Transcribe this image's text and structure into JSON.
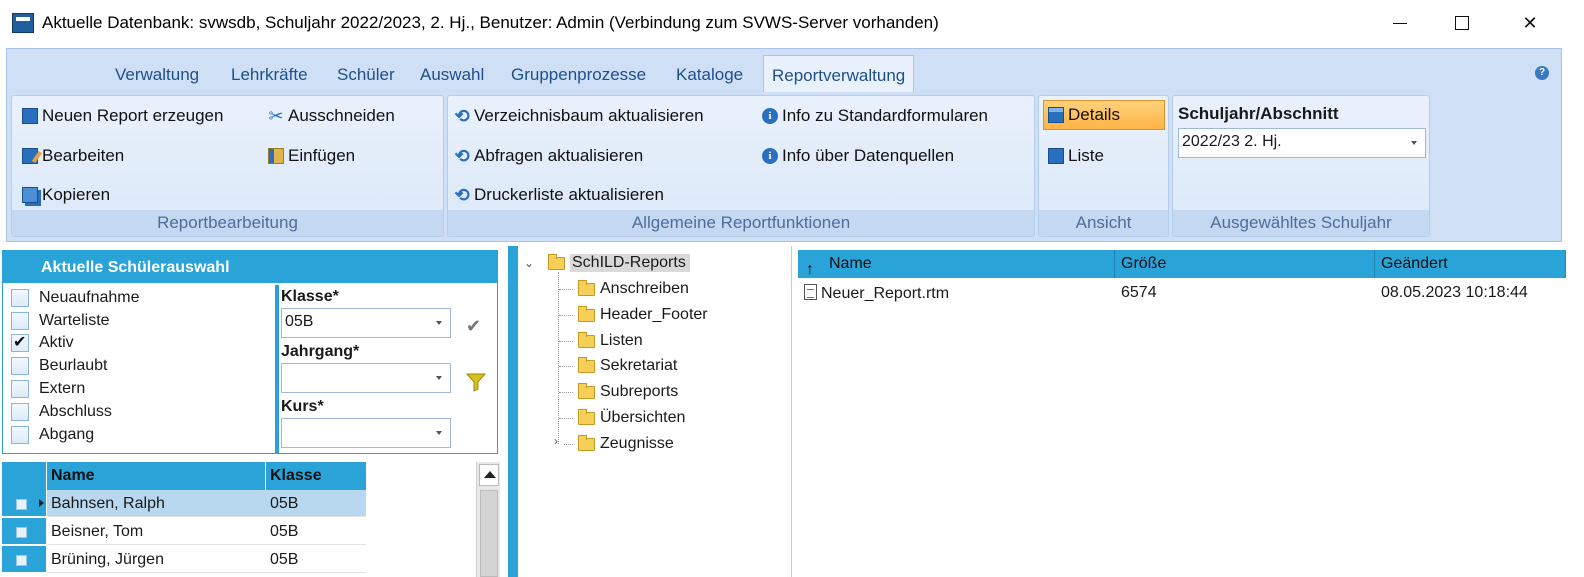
{
  "window": {
    "title": "Aktuelle Datenbank: svwsdb, Schuljahr 2022/2023, 2. Hj., Benutzer: Admin (Verbindung zum SVWS-Server vorhanden)"
  },
  "ribbon": {
    "tabs": [
      {
        "label": "Verwaltung"
      },
      {
        "label": "Lehrkräfte"
      },
      {
        "label": "Schüler"
      },
      {
        "label": "Auswahl"
      },
      {
        "label": "Gruppenprozesse"
      },
      {
        "label": "Kataloge"
      },
      {
        "label": "Reportverwaltung",
        "active": true
      }
    ],
    "reportbearbeitung": {
      "label": "Reportbearbeitung",
      "new_report": "Neuen Report erzeugen",
      "edit": "Bearbeiten",
      "copy": "Kopieren",
      "cut": "Ausschneiden",
      "paste": "Einfügen"
    },
    "allgemein": {
      "label": "Allgemeine Reportfunktionen",
      "refresh_tree": "Verzeichnisbaum aktualisieren",
      "refresh_queries": "Abfragen aktualisieren",
      "refresh_printers": "Druckerliste aktualisieren",
      "info_forms": "Info zu Standardformularen",
      "info_sources": "Info über Datenquellen"
    },
    "ansicht": {
      "label": "Ansicht",
      "details": "Details",
      "liste": "Liste"
    },
    "schuljahr": {
      "label": "Ausgewähltes Schuljahr",
      "heading": "Schuljahr/Abschnitt",
      "value": "2022/23 2. Hj."
    }
  },
  "selection_panel": {
    "title": "Aktuelle Schülerauswahl",
    "statuses": [
      {
        "label": "Neuaufnahme",
        "checked": false
      },
      {
        "label": "Warteliste",
        "checked": false
      },
      {
        "label": "Aktiv",
        "checked": true
      },
      {
        "label": "Beurlaubt",
        "checked": false
      },
      {
        "label": "Extern",
        "checked": false
      },
      {
        "label": "Abschluss",
        "checked": false
      },
      {
        "label": "Abgang",
        "checked": false
      }
    ],
    "klasse_label": "Klasse*",
    "klasse_value": "05B",
    "jahrgang_label": "Jahrgang*",
    "jahrgang_value": "",
    "kurs_label": "Kurs*",
    "kurs_value": ""
  },
  "students": {
    "columns": [
      "Name",
      "Klasse"
    ],
    "rows": [
      {
        "name": "Bahnsen, Ralph",
        "klasse": "05B",
        "selected": true
      },
      {
        "name": "Beisner, Tom",
        "klasse": "05B"
      },
      {
        "name": "Brüning, Jürgen",
        "klasse": "05B"
      }
    ]
  },
  "tree": {
    "root": "SchILD-Reports",
    "children": [
      "Anschreiben",
      "Header_Footer",
      "Listen",
      "Sekretariat",
      "Subreports",
      "Übersichten",
      "Zeugnisse"
    ]
  },
  "files": {
    "columns": [
      "Name",
      "Größe",
      "Geändert"
    ],
    "rows": [
      {
        "name": "Neuer_Report.rtm",
        "size": "6574",
        "modified": "08.05.2023 10:18:44"
      }
    ]
  },
  "colors": {
    "accent": "#2aa3d8",
    "ribbon_bg": "#cfe0f6",
    "selected_button": "#ffb347"
  }
}
